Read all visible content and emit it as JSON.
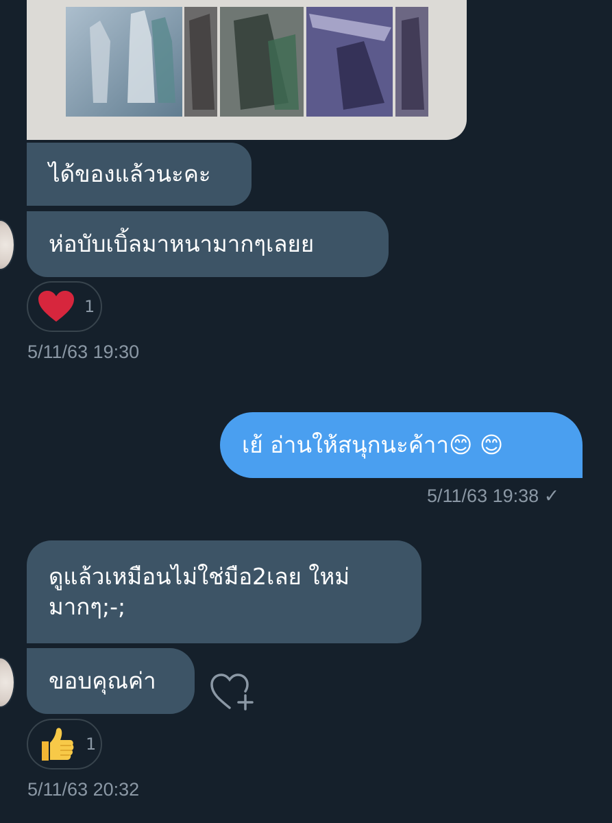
{
  "messages": {
    "m1": "ได้ของแล้วนะคะ",
    "m2": "ห่อบับเบิ้ลมาหนามากๆเลยย",
    "m3": "เย้ อ่านให้สนุกนะค้าา😊 😊",
    "m4_line1": "ดูแล้วเหมือนไม่ใช่มือ2เลย ใหม่",
    "m4_line2": "มากๆ;-;",
    "m5": "ขอบคุณค่า"
  },
  "reactions": {
    "r1": {
      "icon": "heart-icon",
      "count": "1"
    },
    "r2": {
      "icon": "thumbs-up-icon",
      "count": "1"
    }
  },
  "timestamps": {
    "t1": "5/11/63 19:30",
    "t2": "5/11/63 19:38 ✓",
    "t3": "5/11/63 20:32"
  },
  "colors": {
    "background": "#15202b",
    "incoming_bubble": "#3d5466",
    "outgoing_bubble": "#4a9ff0",
    "heart": "#e0245e"
  }
}
